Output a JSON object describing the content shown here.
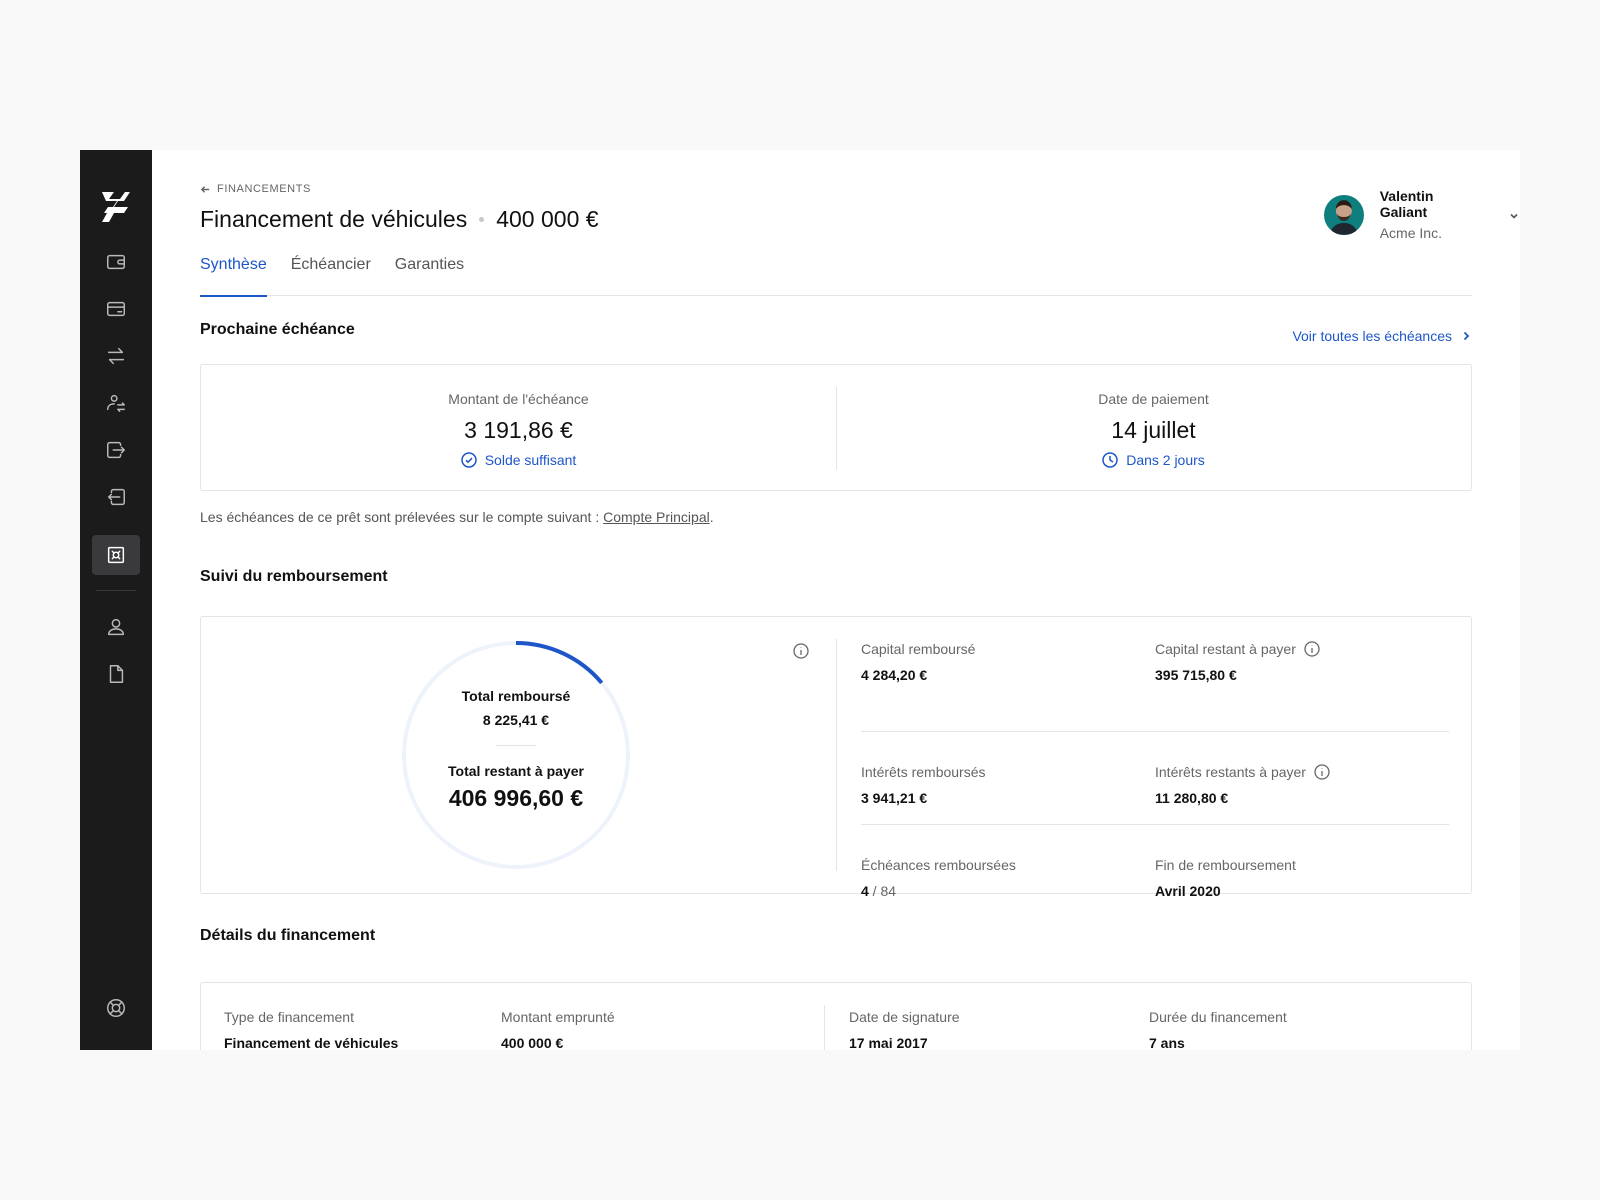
{
  "header": {
    "back_label": "FINANCEMENTS",
    "title": "Financement de véhicules",
    "amount": "400 000 €"
  },
  "tabs": [
    {
      "label": "Synthèse",
      "active": true
    },
    {
      "label": "Échéancier",
      "active": false
    },
    {
      "label": "Garanties",
      "active": false
    }
  ],
  "user": {
    "name": "Valentin Galiant",
    "company": "Acme Inc."
  },
  "sidebar": {
    "icons": [
      "wallet-icon",
      "card-icon",
      "transfer-icon",
      "beneficiaries-icon",
      "outgoing-icon",
      "incoming-icon",
      "safe-icon",
      "user-icon",
      "document-icon",
      "help-icon"
    ],
    "active": "safe-icon"
  },
  "next_due": {
    "section_title": "Prochaine échéance",
    "link_label": "Voir toutes les échéances",
    "amount_label": "Montant de l'échéance",
    "amount_value": "3 191,86 €",
    "amount_status": "Solde suffisant",
    "date_label": "Date de paiement",
    "date_value": "14 juillet",
    "date_status": "Dans 2 jours",
    "note_prefix": "Les échéances de ce prêt sont prélevées sur le compte suivant : ",
    "note_account": "Compte Principal",
    "note_suffix": "."
  },
  "repayment": {
    "section_title": "Suivi du remboursement",
    "total_repaid_label": "Total remboursé",
    "total_repaid_value": "8 225,41 €",
    "total_remaining_label": "Total restant à payer",
    "total_remaining_value": "406 996,60 €",
    "progress_fraction": 0.0198,
    "stats": [
      {
        "label": "Capital remboursé",
        "value": "4 284,20 €",
        "info": false
      },
      {
        "label": "Capital restant à payer",
        "value": "395 715,80 €",
        "info": true
      },
      {
        "label": "Intérêts remboursés",
        "value": "3 941,21 €",
        "info": false
      },
      {
        "label": "Intérêts restants à payer",
        "value": "11 280,80 €",
        "info": true
      },
      {
        "label": "Échéances remboursées",
        "value": "4",
        "value_suffix": " / 84",
        "info": false
      },
      {
        "label": "Fin de remboursement",
        "value": "Avril 2020",
        "info": false
      }
    ]
  },
  "details": {
    "section_title": "Détails du financement",
    "fields": [
      {
        "label": "Type de financement",
        "value": "Financement de véhicules"
      },
      {
        "label": "Montant emprunté",
        "value": "400 000 €"
      },
      {
        "label": "Date de signature",
        "value": "17 mai 2017"
      },
      {
        "label": "Durée du financement",
        "value": "7 ans"
      }
    ]
  },
  "colors": {
    "accent": "#1d56c9",
    "sidebar_bg": "#1b1b1c",
    "donut_track": "#eef3fb"
  }
}
